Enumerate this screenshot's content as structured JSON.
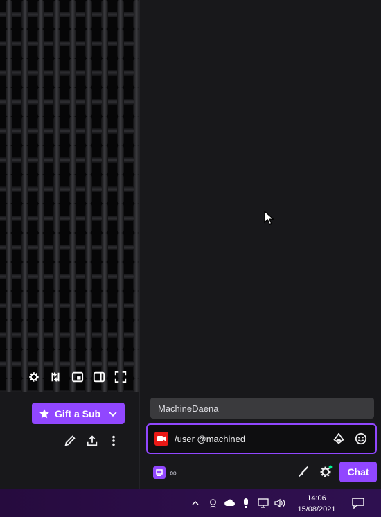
{
  "player": {
    "controls": [
      "settings-icon",
      "clip-icon",
      "miniplayer-icon",
      "theatre-mode-icon",
      "fullscreen-icon"
    ]
  },
  "channel": {
    "gift_label": "Gift a Sub",
    "actions": [
      "edit-icon",
      "share-icon",
      "more-icon"
    ]
  },
  "chat": {
    "name_field_value": "MachineDaena",
    "input_value": "/user @machined",
    "points_value": "∞",
    "send_label": "Chat"
  },
  "taskbar": {
    "time": "14:06",
    "date": "15/08/2021"
  },
  "colors": {
    "accent": "#9147ff",
    "background": "#18181b",
    "input_bg": "#0e0e10",
    "taskbar": "#2d0e4a",
    "camera_red": "#e91916"
  }
}
